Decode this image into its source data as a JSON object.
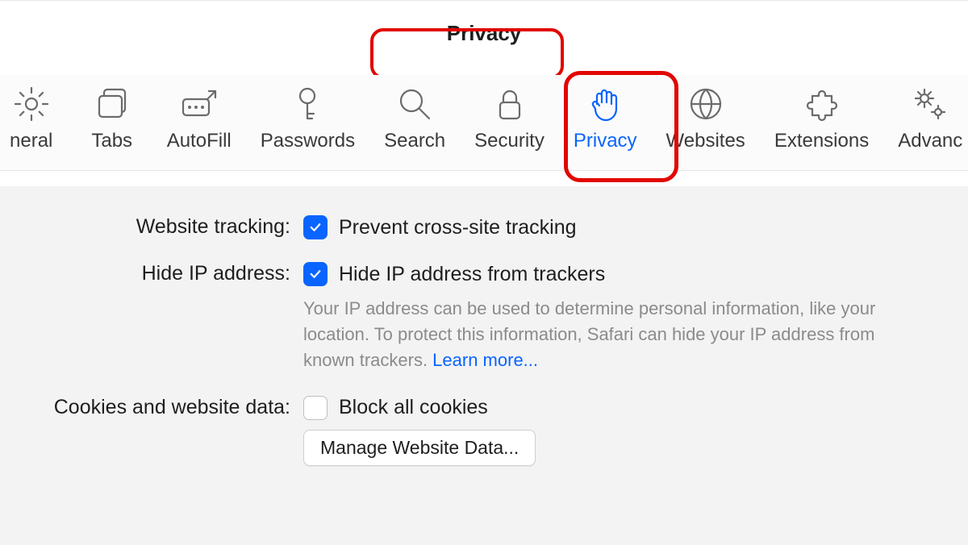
{
  "title": "Privacy",
  "toolbar": [
    {
      "id": "general",
      "label": "neral",
      "icon": "gear-icon",
      "selected": false,
      "cut": "left"
    },
    {
      "id": "tabs",
      "label": "Tabs",
      "icon": "tabs-icon",
      "selected": false
    },
    {
      "id": "autofill",
      "label": "AutoFill",
      "icon": "autofill-icon",
      "selected": false
    },
    {
      "id": "passwords",
      "label": "Passwords",
      "icon": "key-icon",
      "selected": false
    },
    {
      "id": "search",
      "label": "Search",
      "icon": "search-icon",
      "selected": false
    },
    {
      "id": "security",
      "label": "Security",
      "icon": "lock-icon",
      "selected": false
    },
    {
      "id": "privacy",
      "label": "Privacy",
      "icon": "hand-icon",
      "selected": true
    },
    {
      "id": "websites",
      "label": "Websites",
      "icon": "globe-icon",
      "selected": false
    },
    {
      "id": "extensions",
      "label": "Extensions",
      "icon": "puzzle-icon",
      "selected": false
    },
    {
      "id": "advanced",
      "label": "Advanc",
      "icon": "gears-icon",
      "selected": false,
      "cut": "right"
    }
  ],
  "sections": {
    "tracking": {
      "label": "Website tracking:",
      "checkbox_label": "Prevent cross-site tracking",
      "checked": true
    },
    "hide_ip": {
      "label": "Hide IP address:",
      "checkbox_label": "Hide IP address from trackers",
      "checked": true,
      "description": "Your IP address can be used to determine personal information, like your location. To protect this information, Safari can hide your IP address from known trackers. ",
      "learn_more": "Learn more..."
    },
    "cookies": {
      "label": "Cookies and website data:",
      "checkbox_label": "Block all cookies",
      "checked": false,
      "button": "Manage Website Data..."
    }
  },
  "annotations": {
    "title_highlight": true,
    "privacy_tab_highlight": true
  }
}
